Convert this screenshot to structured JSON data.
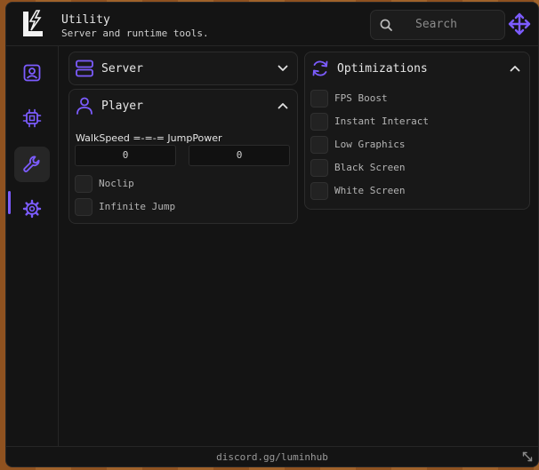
{
  "header": {
    "title": "Utility",
    "subtitle": "Server and runtime tools.",
    "search_placeholder": "Search"
  },
  "sidebar": {
    "items": [
      {
        "icon": "profile-icon"
      },
      {
        "icon": "chip-icon"
      },
      {
        "icon": "wrench-icon",
        "active": true
      },
      {
        "icon": "gear-icon"
      }
    ]
  },
  "server": {
    "label": "Server",
    "expanded": false
  },
  "player": {
    "label": "Player",
    "expanded": true,
    "speed_label": "WalkSpeed =-=-= JumpPower",
    "walkspeed": "0",
    "jumppower": "0",
    "toggles": [
      "Noclip",
      "Infinite Jump"
    ]
  },
  "optimizations": {
    "label": "Optimizations",
    "expanded": true,
    "toggles": [
      "FPS Boost",
      "Instant Interact",
      "Low Graphics",
      "Black Screen",
      "White Screen"
    ]
  },
  "footer": {
    "text": "discord.gg/luminhub"
  },
  "colors": {
    "accent": "#7c5cff",
    "background": "#141414",
    "panel": "#181818"
  }
}
